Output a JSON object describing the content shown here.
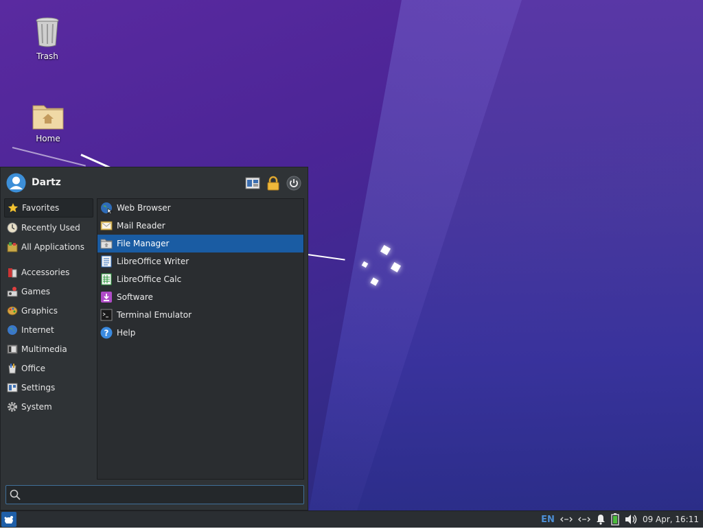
{
  "desktop": {
    "icons": [
      {
        "label": "Trash",
        "icon": "trash-icon"
      },
      {
        "label": "Home",
        "icon": "home-folder-icon"
      }
    ]
  },
  "menu": {
    "user": {
      "name": "Dartz",
      "icon": "user-avatar-icon"
    },
    "header_buttons": [
      {
        "icon": "settings-manager-icon"
      },
      {
        "icon": "lock-icon"
      },
      {
        "icon": "power-icon"
      }
    ],
    "categories": [
      {
        "label": "Favorites",
        "icon": "star-icon",
        "active": true
      },
      {
        "label": "Recently Used",
        "icon": "clock-icon"
      },
      {
        "label": "All Applications",
        "icon": "applications-icon"
      },
      {
        "label": "Accessories",
        "icon": "accessories-icon"
      },
      {
        "label": "Games",
        "icon": "games-icon"
      },
      {
        "label": "Graphics",
        "icon": "graphics-icon"
      },
      {
        "label": "Internet",
        "icon": "globe-icon"
      },
      {
        "label": "Multimedia",
        "icon": "multimedia-icon"
      },
      {
        "label": "Office",
        "icon": "office-icon"
      },
      {
        "label": "Settings",
        "icon": "settings-icon"
      },
      {
        "label": "System",
        "icon": "gear-icon"
      }
    ],
    "apps": [
      {
        "label": "Web Browser",
        "icon": "web-browser-icon"
      },
      {
        "label": "Mail Reader",
        "icon": "mail-icon"
      },
      {
        "label": "File Manager",
        "icon": "file-manager-icon",
        "selected": true
      },
      {
        "label": "LibreOffice Writer",
        "icon": "writer-icon"
      },
      {
        "label": "LibreOffice Calc",
        "icon": "calc-icon"
      },
      {
        "label": "Software",
        "icon": "software-icon"
      },
      {
        "label": "Terminal Emulator",
        "icon": "terminal-icon"
      },
      {
        "label": "Help",
        "icon": "help-icon"
      }
    ],
    "search": {
      "value": "",
      "placeholder": "",
      "icon": "search-icon"
    }
  },
  "panel": {
    "menu_button_icon": "whisker-menu-icon",
    "keyboard_layout": "EN",
    "tray_icons": [
      "network-icon",
      "network-icon",
      "bell-icon",
      "battery-icon",
      "volume-icon"
    ],
    "clock": "09 Apr, 16:11"
  },
  "colors": {
    "accent": "#1a5ca3",
    "panel": "#2a2e32",
    "menu_bg": "#2f3336"
  }
}
